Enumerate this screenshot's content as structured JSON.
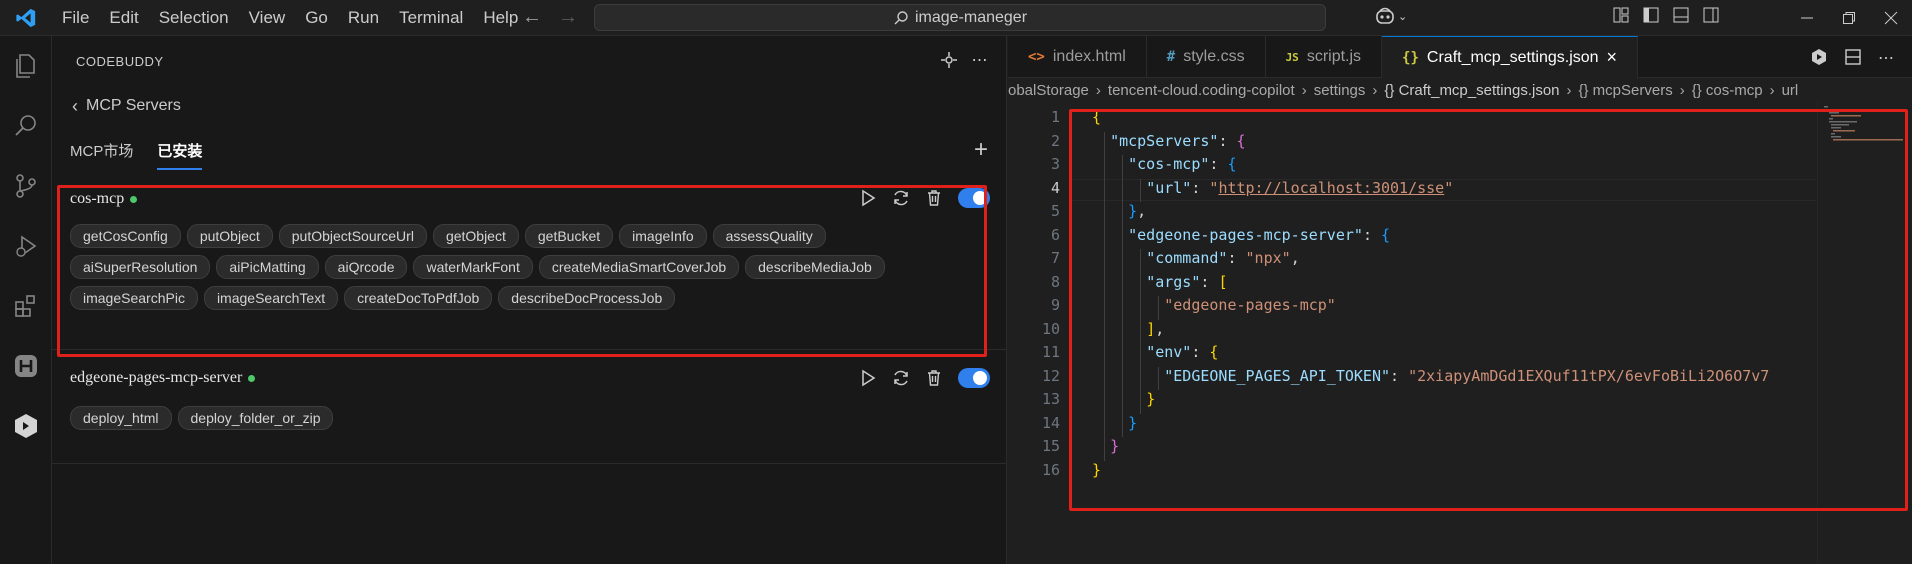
{
  "menu": [
    "File",
    "Edit",
    "Selection",
    "View",
    "Go",
    "Run",
    "Terminal",
    "Help"
  ],
  "search": {
    "text": "image-maneger"
  },
  "sidebar": {
    "title": "CODEBUDDY",
    "back_label": "MCP Servers",
    "tabs": [
      "MCP市场",
      "已安装"
    ],
    "servers": [
      {
        "name": "cos-mcp",
        "tools": [
          "getCosConfig",
          "putObject",
          "putObjectSourceUrl",
          "getObject",
          "getBucket",
          "imageInfo",
          "assessQuality",
          "aiSuperResolution",
          "aiPicMatting",
          "aiQrcode",
          "waterMarkFont",
          "createMediaSmartCoverJob",
          "describeMediaJob",
          "imageSearchPic",
          "imageSearchText",
          "createDocToPdfJob",
          "describeDocProcessJob"
        ]
      },
      {
        "name": "edgeone-pages-mcp-server",
        "tools": [
          "deploy_html",
          "deploy_folder_or_zip"
        ]
      }
    ]
  },
  "editor": {
    "tabs": [
      {
        "icon": "<>",
        "label": "index.html"
      },
      {
        "icon": "#",
        "label": "style.css"
      },
      {
        "icon": "JS",
        "label": "script.js"
      },
      {
        "icon": "{}",
        "label": "Craft_mcp_settings.json"
      }
    ],
    "breadcrumb": [
      "obalStorage",
      "›",
      "tencent-cloud.coding-copilot",
      "›",
      "settings",
      "›",
      "{} Craft_mcp_settings.json",
      "›",
      "{} mcpServers",
      "›",
      "{} cos-mcp",
      "›",
      "url"
    ],
    "code": [
      {
        "n": "1",
        "t": "{"
      },
      {
        "n": "2",
        "t": "  \"mcpServers\": {"
      },
      {
        "n": "3",
        "t": "    \"cos-mcp\": {"
      },
      {
        "n": "4",
        "t": "      \"url\": \"http://localhost:3001/sse\""
      },
      {
        "n": "5",
        "t": "    },"
      },
      {
        "n": "6",
        "t": "    \"edgeone-pages-mcp-server\": {"
      },
      {
        "n": "7",
        "t": "      \"command\": \"npx\","
      },
      {
        "n": "8",
        "t": "      \"args\": ["
      },
      {
        "n": "9",
        "t": "        \"edgeone-pages-mcp\""
      },
      {
        "n": "10",
        "t": "      ],"
      },
      {
        "n": "11",
        "t": "      \"env\": {"
      },
      {
        "n": "12",
        "t": "        \"EDGEONE_PAGES_API_TOKEN\": \"2xiapyAmDGd1EXQuf11tPX/6evFoBiLi2O6O7v7"
      },
      {
        "n": "13",
        "t": "      }"
      },
      {
        "n": "14",
        "t": "    }"
      },
      {
        "n": "15",
        "t": "  }"
      },
      {
        "n": "16",
        "t": "}"
      }
    ],
    "current_line": 4
  },
  "colors": {
    "accent": "#2f80ed",
    "highlight_box": "#e0201b",
    "status_dot": "#4ec969"
  }
}
